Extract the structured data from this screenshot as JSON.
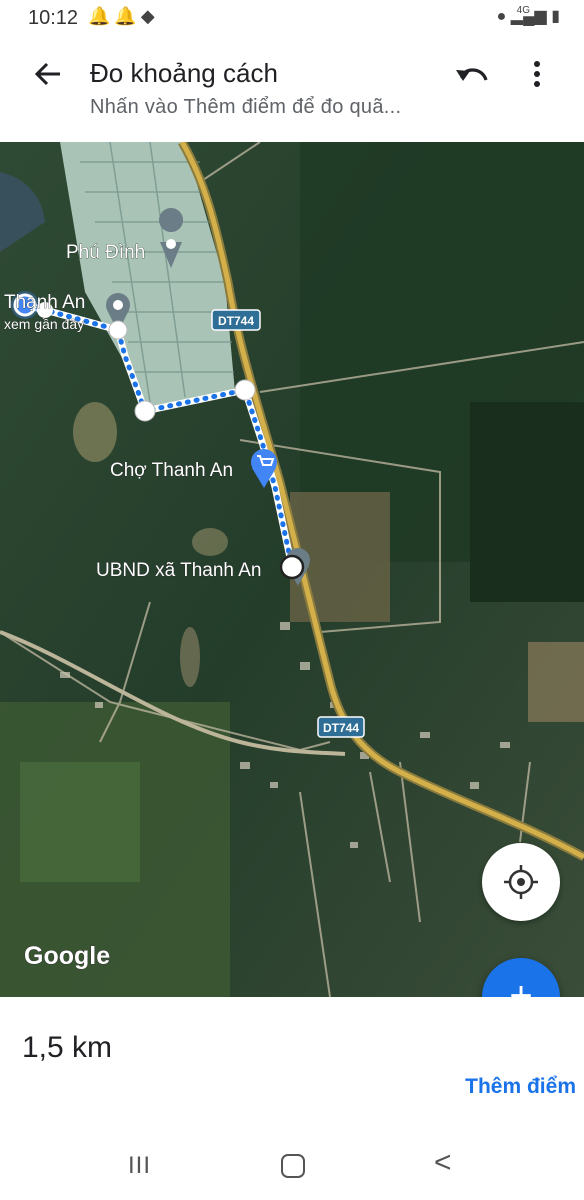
{
  "status_bar": {
    "time": "10:12",
    "network": "4G",
    "left_icons": [
      "alarm-icon",
      "notification-icon",
      "app-icon"
    ],
    "right_icons": [
      "location-icon",
      "signal-icon",
      "battery-icon"
    ]
  },
  "header": {
    "title": "Đo khoảng cách",
    "subtitle": "Nhấn vào Thêm điểm để đo quã...",
    "icons": [
      "back-arrow-icon",
      "undo-icon",
      "more-vert-icon"
    ]
  },
  "map": {
    "labels": {
      "phu_dinh": "Phú Đình",
      "thanh_an": "Thạnh An",
      "xem_gan_day": "xem gần đây",
      "cho_thanh_an": "Chợ Thanh An",
      "ubnd": "UBND xã Thanh An",
      "road_top": "DT744",
      "road_bottom": "DT744",
      "google": "Google"
    },
    "colors": {
      "route": "#1a73e8",
      "road": "#d4b04a",
      "satellite_dark": "#1e3a26"
    }
  },
  "controls": {
    "locate_icon": "my-location-icon",
    "add_icon": "+"
  },
  "sheet": {
    "distance": "1,5 km",
    "add_point": "Thêm điểm"
  },
  "nav": {
    "recent": "III",
    "back": "<"
  }
}
